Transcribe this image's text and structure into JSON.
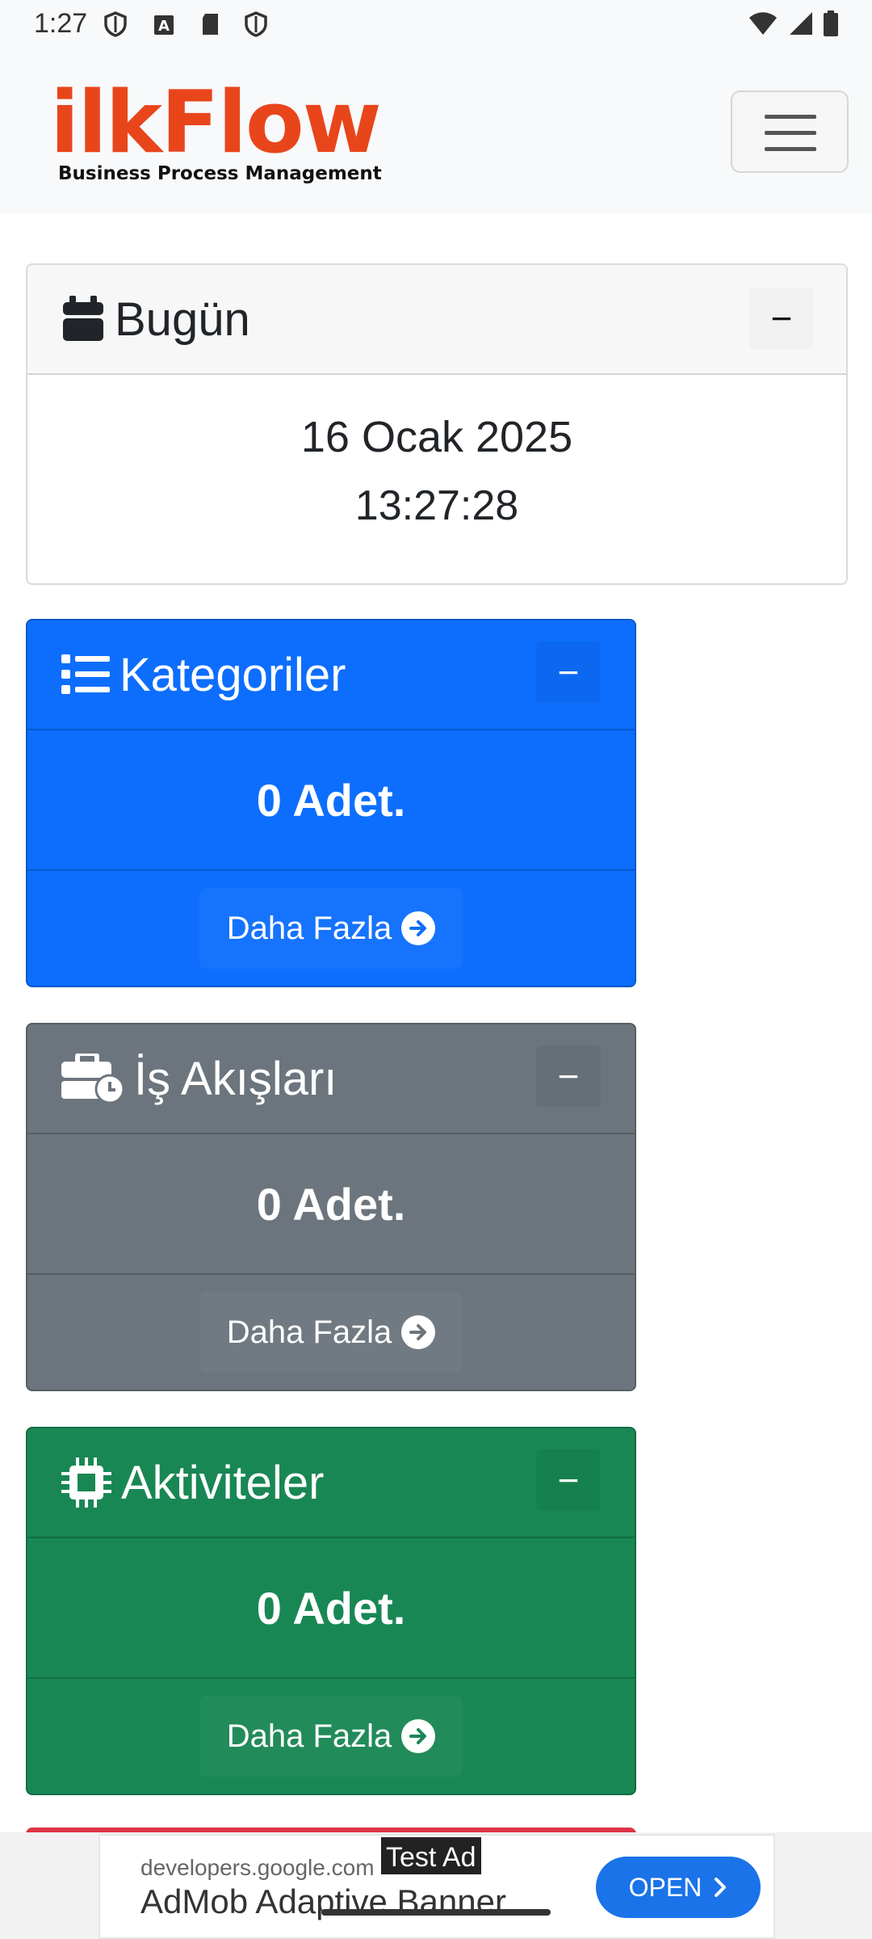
{
  "status_bar": {
    "time": "1:27"
  },
  "navbar": {
    "logo_text": "ilkFlow",
    "logo_subtitle": "Business Process Management"
  },
  "today_card": {
    "title": "Bugün",
    "date": "16 Ocak 2025",
    "time": "13:27:28",
    "collapse_symbol": "−"
  },
  "stat_cards": [
    {
      "title": "Kategoriler",
      "count": "0 Adet.",
      "more_label": "Daha Fazla",
      "color": "#0d6efd",
      "icon": "list-icon"
    },
    {
      "title": "İş Akışları",
      "count": "0 Adet.",
      "more_label": "Daha Fazla",
      "color": "#6c757d",
      "icon": "business-time-icon"
    },
    {
      "title": "Aktiviteler",
      "count": "0 Adet.",
      "more_label": "Daha Fazla",
      "color": "#198754",
      "icon": "microchip-icon"
    }
  ],
  "ad": {
    "domain": "developers.google.com",
    "title": "AdMob Adaptive Banner",
    "tag": "Test Ad",
    "open_label": "OPEN"
  }
}
